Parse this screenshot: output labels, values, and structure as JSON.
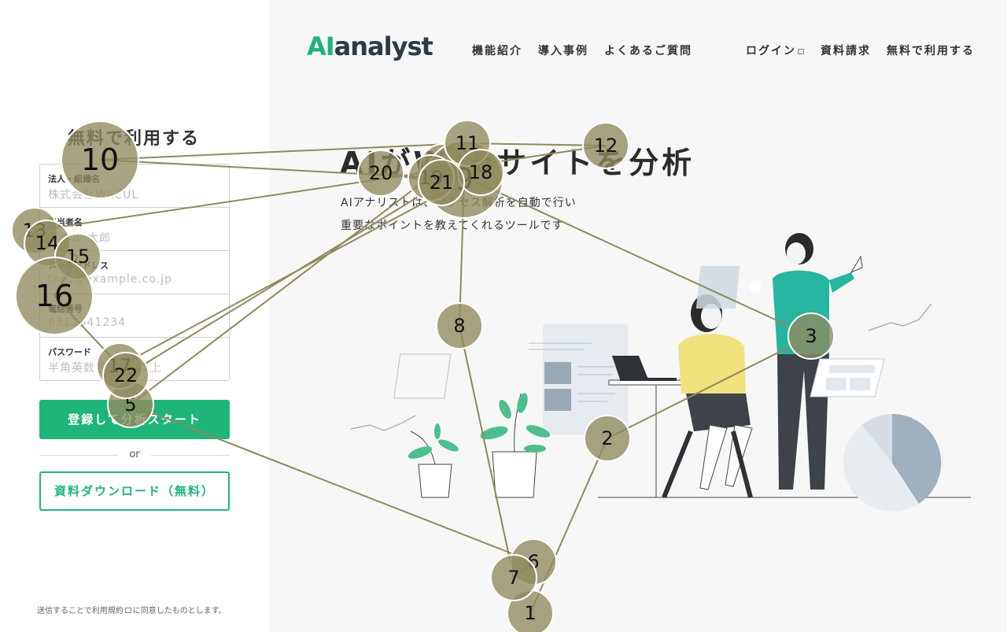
{
  "form": {
    "title": "無料で利用する",
    "fields": [
      {
        "label": "法人・組織名",
        "placeholder": "株式会社WACUL"
      },
      {
        "label": "担当者名",
        "placeholder": "ワクル 太郎"
      },
      {
        "label": "メールアドレス",
        "placeholder": "taro@example.co.jp"
      },
      {
        "label": "電話番号",
        "placeholder": "0312341234"
      },
      {
        "label": "パスワード",
        "placeholder": "半角英数字8文字以上"
      }
    ],
    "submit_label": "登録して分析スタート",
    "or_label": "or",
    "download_label": "資料ダウンロード（無料）",
    "terms_prefix": "送信することで",
    "terms_link": "利用規約",
    "terms_suffix": "に同意したものとします。"
  },
  "header": {
    "logo_ai": "AI",
    "logo_rest": "analyst",
    "nav": [
      "機能紹介",
      "導入事例",
      "よくあるご質問"
    ],
    "login": "ログイン",
    "request": "資料請求",
    "free": "無料で利用する"
  },
  "hero": {
    "title": "AIがWebサイトを分析",
    "sub1": "AIアナリストは、アクセス解析を自動で行い",
    "sub2": "重要なポイントを教えてくれるツールです"
  },
  "gaze": {
    "color": "#8f8a5e",
    "fixations": [
      {
        "n": "1",
        "size": "small"
      },
      {
        "n": "2",
        "size": "small"
      },
      {
        "n": "3",
        "size": "small"
      },
      {
        "n": "4",
        "size": "small"
      },
      {
        "n": "5",
        "size": "small"
      },
      {
        "n": "6",
        "size": "small"
      },
      {
        "n": "7",
        "size": "small"
      },
      {
        "n": "8",
        "size": "small"
      },
      {
        "n": "9",
        "size": "large"
      },
      {
        "n": "10",
        "size": "large"
      },
      {
        "n": "11",
        "size": "small"
      },
      {
        "n": "12",
        "size": "small"
      },
      {
        "n": "13",
        "size": "small"
      },
      {
        "n": "14",
        "size": "small"
      },
      {
        "n": "15",
        "size": "small"
      },
      {
        "n": "16",
        "size": "large"
      },
      {
        "n": "17",
        "size": "small"
      },
      {
        "n": "18",
        "size": "small"
      },
      {
        "n": "19",
        "size": "small"
      },
      {
        "n": "20",
        "size": "small"
      },
      {
        "n": "21",
        "size": "small"
      },
      {
        "n": "22",
        "size": "small"
      }
    ]
  }
}
